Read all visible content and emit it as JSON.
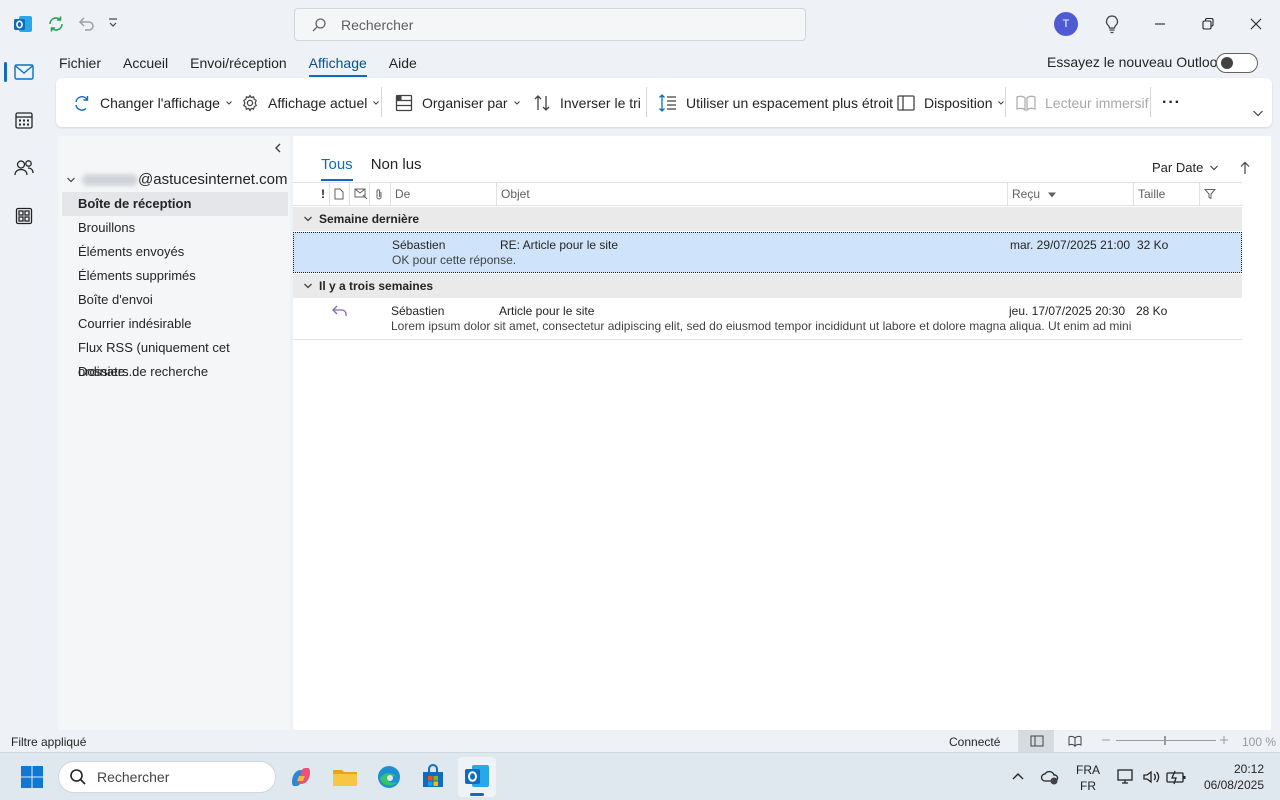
{
  "titlebar": {
    "search_placeholder": "Rechercher",
    "avatar_initial": "T"
  },
  "menu": {
    "items": [
      "Fichier",
      "Accueil",
      "Envoi/réception",
      "Affichage",
      "Aide"
    ],
    "active": "Affichage",
    "try_new": "Essayez le nouveau Outlook"
  },
  "ribbon": {
    "change_view": "Changer l'affichage",
    "current_view": "Affichage actuel",
    "arrange_by": "Organiser par",
    "reverse_sort": "Inverser le tri",
    "compact_spacing": "Utiliser un espacement plus étroit",
    "layout": "Disposition",
    "immersive_reader": "Lecteur immersif",
    "more": "···"
  },
  "folders": {
    "account_suffix": "@astucesinternet.com",
    "items": [
      "Boîte de réception",
      "Brouillons",
      "Éléments envoyés",
      "Éléments supprimés",
      "Boîte d'envoi",
      "Courrier indésirable",
      "Flux RSS (uniquement cet ordinate...",
      "Dossiers de recherche"
    ],
    "selected": "Boîte de réception"
  },
  "maillist": {
    "tabs": [
      "Tous",
      "Non lus"
    ],
    "active_tab": "Tous",
    "sort_label": "Par Date",
    "columns": {
      "importance": "!",
      "from": "De",
      "subject": "Objet",
      "received": "Reçu",
      "size": "Taille"
    },
    "groups": [
      {
        "label": "Semaine dernière",
        "messages": [
          {
            "from": "Sébastien",
            "subject": "RE: Article pour le site",
            "preview": "OK pour cette réponse.",
            "received": "mar. 29/07/2025 21:00",
            "size": "32 Ko",
            "replied": false,
            "selected": true
          }
        ]
      },
      {
        "label": "Il y a trois semaines",
        "messages": [
          {
            "from": "Sébastien",
            "subject": "Article pour le site",
            "preview": "Lorem ipsum dolor sit amet, consectetur adipiscing elit, sed do eiusmod tempor incididunt ut labore et dolore magna aliqua. Ut enim ad minim",
            "received": "jeu. 17/07/2025 20:30",
            "size": "28 Ko",
            "replied": true,
            "selected": false
          }
        ]
      }
    ]
  },
  "statusbar": {
    "filter": "Filtre appliqué",
    "connection": "Connecté",
    "zoom": "100 %"
  },
  "taskbar": {
    "search_placeholder": "Rechercher",
    "lang_top": "FRA",
    "lang_bottom": "FR",
    "time": "20:12",
    "date": "06/08/2025"
  },
  "colors": {
    "accent": "#0f6cbd",
    "selected_row": "#cfe4fa",
    "reply_icon": "#8764b8"
  }
}
